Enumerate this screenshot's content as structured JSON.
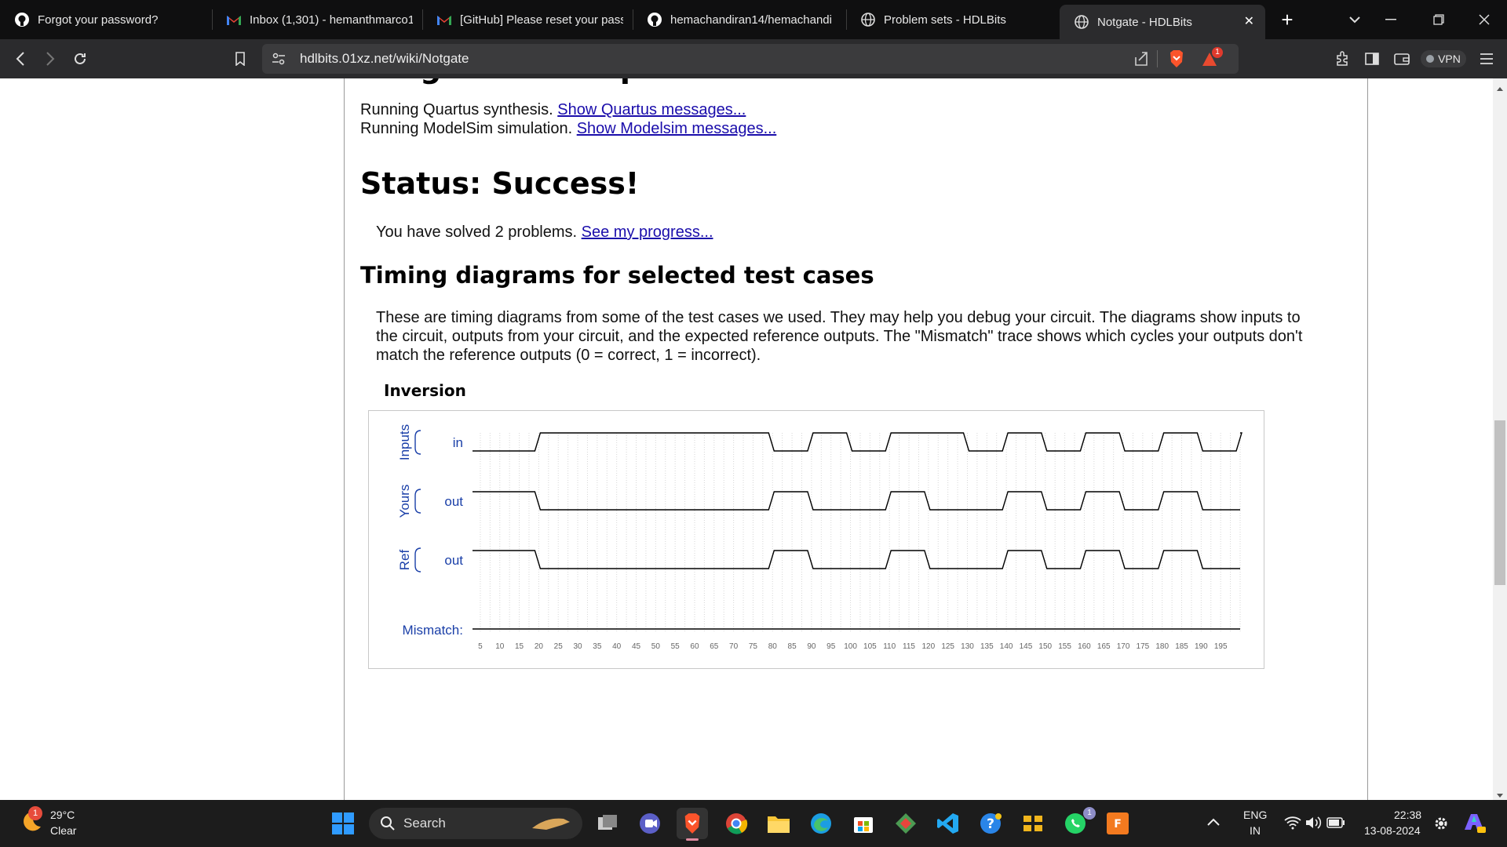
{
  "browser": {
    "tabs": [
      {
        "label": "Forgot your password?",
        "icon": "github-icon"
      },
      {
        "label": "Inbox (1,301) - hemanthmarco1",
        "icon": "gmail-icon"
      },
      {
        "label": "[GitHub] Please reset your pass",
        "icon": "gmail-icon"
      },
      {
        "label": "hemachandiran14/hemachandi",
        "icon": "github-icon"
      },
      {
        "label": "Problem sets - HDLBits",
        "icon": "globe-icon"
      },
      {
        "label": "Notgate - HDLBits",
        "icon": "globe-icon",
        "active": true
      }
    ],
    "close_tab": "✕",
    "new_tab": "+",
    "url": "hdlbits.01xz.net/wiki/Notgate",
    "vpn_label": "VPN",
    "brave_alert_count": "1"
  },
  "page": {
    "partial_title": "Notgate — Compile and simulate",
    "line1_prefix": "Running Quartus synthesis.",
    "line1_link": "Show Quartus messages...",
    "line2_prefix": "Running ModelSim simulation.",
    "line2_link": "Show Modelsim messages...",
    "status_heading": "Status: Success!",
    "solved_text": "You have solved 2 problems.",
    "progress_link": "See my progress...",
    "timing_heading": "Timing diagrams for selected test cases",
    "timing_desc_1": "These are timing diagrams from some of the test cases we used. They may help you debug your circuit. The diagrams show inputs to",
    "timing_desc_2": "the circuit, outputs from your circuit, and the expected reference outputs. The \"Mismatch\" trace shows which cycles your outputs don't",
    "timing_desc_3": "match the reference outputs (0 = correct, 1 = incorrect).",
    "diagram_title": "Inversion"
  },
  "chart_data": {
    "type": "line",
    "title": "Inversion",
    "x_ticks": [
      5,
      10,
      15,
      20,
      25,
      30,
      35,
      40,
      45,
      50,
      55,
      60,
      65,
      70,
      75,
      80,
      85,
      90,
      95,
      100,
      105,
      110,
      115,
      120,
      125,
      130,
      135,
      140,
      145,
      150,
      155,
      160,
      165,
      170,
      175,
      180,
      185,
      190,
      195
    ],
    "x_range": [
      3,
      200
    ],
    "groups": [
      {
        "label": "Inputs",
        "signal": "in"
      },
      {
        "label": "Yours",
        "signal": "out"
      },
      {
        "label": "Ref",
        "signal": "out"
      }
    ],
    "mismatch_label": "Mismatch:",
    "series": [
      {
        "name": "in",
        "group": "Inputs",
        "initial": 0,
        "transitions": [
          [
            19,
            1
          ],
          [
            79,
            0
          ],
          [
            89,
            1
          ],
          [
            99,
            0
          ],
          [
            109,
            1
          ],
          [
            129,
            0
          ],
          [
            139,
            1
          ],
          [
            149,
            0
          ],
          [
            159,
            1
          ],
          [
            169,
            0
          ],
          [
            179,
            1
          ],
          [
            189,
            0
          ],
          [
            199,
            1
          ]
        ]
      },
      {
        "name": "out",
        "group": "Yours",
        "initial": 1,
        "transitions": [
          [
            19,
            0
          ],
          [
            79,
            1
          ],
          [
            89,
            0
          ],
          [
            109,
            1
          ],
          [
            119,
            0
          ],
          [
            139,
            1
          ],
          [
            149,
            0
          ],
          [
            159,
            1
          ],
          [
            169,
            0
          ],
          [
            179,
            1
          ],
          [
            189,
            0
          ]
        ]
      },
      {
        "name": "out",
        "group": "Ref",
        "initial": 1,
        "transitions": [
          [
            19,
            0
          ],
          [
            79,
            1
          ],
          [
            89,
            0
          ],
          [
            109,
            1
          ],
          [
            119,
            0
          ],
          [
            139,
            1
          ],
          [
            149,
            0
          ],
          [
            159,
            1
          ],
          [
            169,
            0
          ],
          [
            179,
            1
          ],
          [
            189,
            0
          ]
        ]
      },
      {
        "name": "Mismatch",
        "initial": 0,
        "transitions": []
      }
    ],
    "grid": true,
    "trace_color": "#000000",
    "label_color": "#1a3fa8"
  },
  "taskbar": {
    "weather_temp": "29°C",
    "weather_desc": "Clear",
    "weather_badge": "1",
    "search_placeholder": "Search",
    "lang_top": "ENG",
    "lang_bottom": "IN",
    "time": "22:38",
    "date": "13-08-2024",
    "whatsapp_badge": "1"
  },
  "colors": {
    "tab_bg": "#0f0f10",
    "toolbar_bg": "#2b2b2d",
    "link": "#1a0dab",
    "taskbar_bg": "#1c1c1c"
  }
}
